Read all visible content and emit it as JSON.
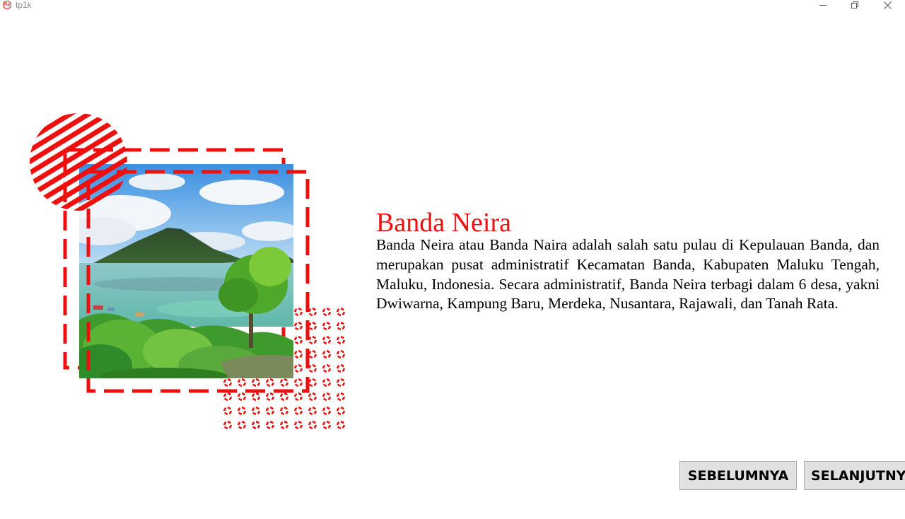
{
  "window": {
    "title": "tp1k",
    "icon_label": "Rp",
    "controls": {
      "minimize_icon": "minimize-icon",
      "restore_icon": "restore-icon",
      "close_icon": "close-icon"
    }
  },
  "content": {
    "title": "Banda Neira",
    "description": "Banda Neira atau Banda Naira adalah salah satu pulau di Kepulauan Banda, dan merupakan pusat administratif Kecamatan Banda, Kabupaten Maluku Tengah, Maluku, Indonesia. Secara administratif, Banda Neira terbagi dalam 6 desa, yakni Dwiwarna, Kampung Baru, Merdeka, Nusantara, Rajawali, dan Tanah Rata.",
    "image": {
      "subject": "volcanic island with turquoise lagoon and green trees"
    }
  },
  "navigation": {
    "prev_label": "SEBELUMNYA",
    "next_label": "SELANJUTNYA"
  },
  "colors": {
    "accent": "#ee0f0f",
    "button_bg": "#e1e1e1",
    "button_border": "#adadad"
  }
}
